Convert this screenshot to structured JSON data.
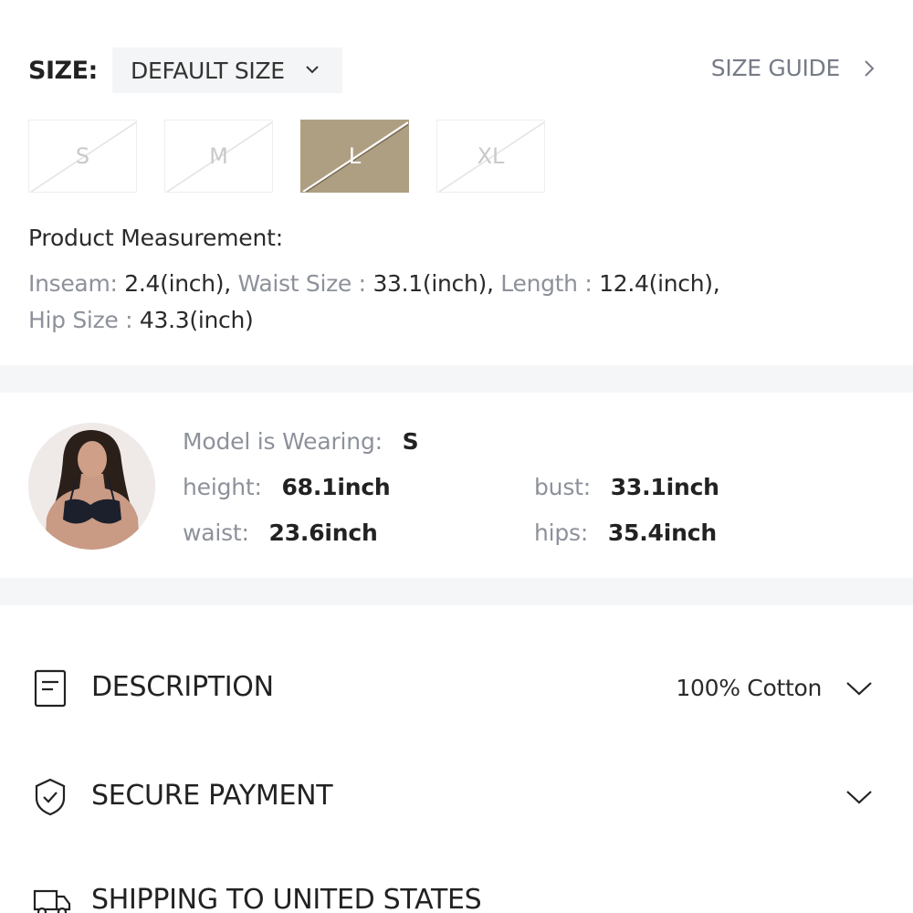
{
  "size": {
    "label": "SIZE:",
    "selected_value": "DEFAULT SIZE",
    "guide_label": "SIZE GUIDE",
    "options": [
      {
        "label": "S",
        "selected": false,
        "unavailable": true
      },
      {
        "label": "M",
        "selected": false,
        "unavailable": true
      },
      {
        "label": "L",
        "selected": true,
        "unavailable": true
      },
      {
        "label": "XL",
        "selected": false,
        "unavailable": true
      }
    ]
  },
  "measurement": {
    "title": "Product Measurement:",
    "items": [
      {
        "key": "Inseam:",
        "value": "2.4(inch),"
      },
      {
        "key": "Waist Size :",
        "value": "33.1(inch),"
      },
      {
        "key": "Length :",
        "value": "12.4(inch),"
      },
      {
        "key": "Hip Size :",
        "value": "43.3(inch)"
      }
    ]
  },
  "model": {
    "wearing_label": "Model is Wearing:",
    "wearing_value": "S",
    "height_label": "height:",
    "height_value": "68.1inch",
    "bust_label": "bust:",
    "bust_value": "33.1inch",
    "waist_label": "waist:",
    "waist_value": "23.6inch",
    "hips_label": "hips:",
    "hips_value": "35.4inch"
  },
  "accordion": {
    "description": {
      "title": "DESCRIPTION",
      "value": "100% Cotton",
      "icon": "document-icon"
    },
    "payment": {
      "title": "SECURE PAYMENT",
      "icon": "shield-check-icon"
    },
    "shipping": {
      "title": "SHIPPING TO UNITED STATES",
      "icon": "truck-icon"
    }
  },
  "colors": {
    "selected_size_bg": "#ae9f82",
    "muted_text": "#8d919a",
    "band": "#f5f6f8"
  }
}
